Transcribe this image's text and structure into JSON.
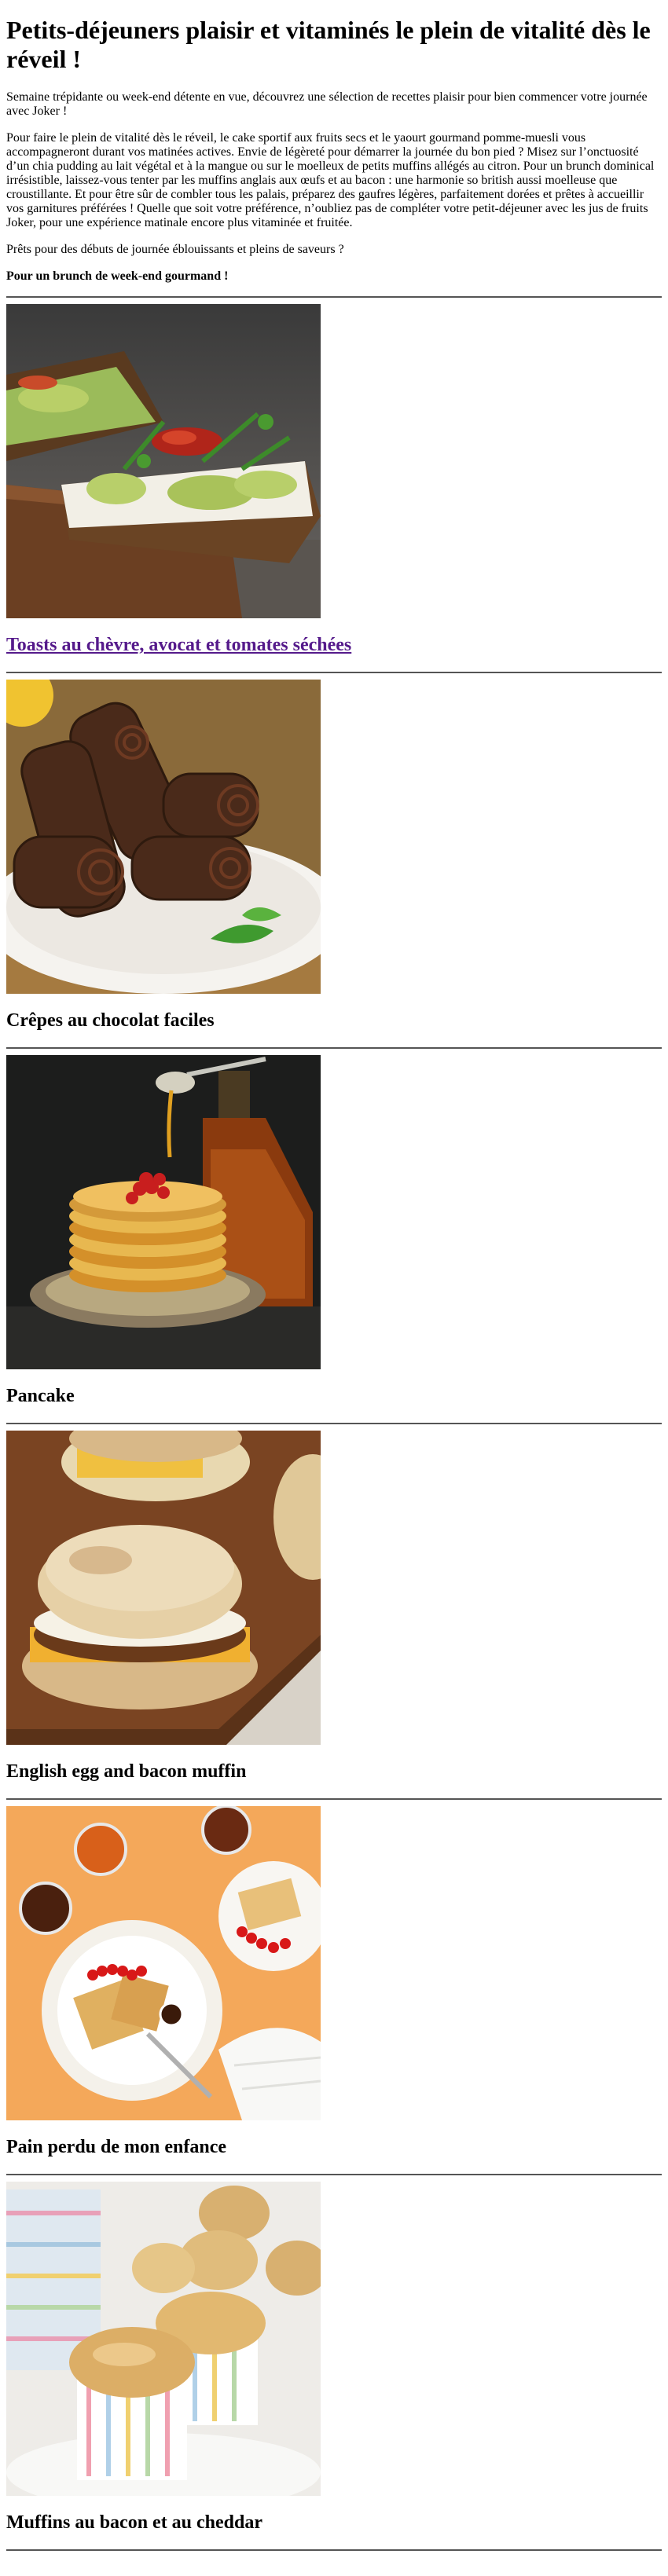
{
  "article": {
    "title": "Petits-déjeuners plaisir et vitaminés le plein de vitalité dès le réveil !",
    "intro_1": "Semaine trépidante ou week-end détente en vue, découvrez une sélection de recettes plaisir pour bien commencer votre journée avec Joker !",
    "intro_2": "Pour faire le plein de vitalité dès le réveil, le cake sportif aux fruits secs et le yaourt gourmand pomme-muesli vous accompagneront durant vos matinées actives. Envie de légèreté pour démarrer la journée du bon pied ? Misez sur l’onctuosité d’un chia pudding au lait végétal et à la mangue ou sur le moelleux de petits muffins allégés au citron. Pour un brunch dominical irrésistible, laissez-vous tenter par les muffins anglais aux œufs et au bacon : une harmonie so british aussi moelleuse que croustillante. Et pour être sûr de combler tous les palais, préparez des gaufres légères, parfaitement dorées et prêtes à accueillir vos garnitures préférées ! Quelle que soit votre préférence, n’oubliez pas de compléter votre petit-déjeuner avec les jus de fruits Joker, pour une expérience matinale encore plus vitaminée et fruitée.",
    "intro_3": "Prêts pour des débuts de journée éblouissants et pleins de saveurs ?",
    "section_heading": "Pour un brunch de week-end gourmand !"
  },
  "recipes": [
    {
      "title": "Toasts au chèvre, avocat et tomates séchées",
      "is_link": true,
      "image": "toast-photo"
    },
    {
      "title": "Crêpes au chocolat faciles",
      "is_link": false,
      "image": "crepes-photo"
    },
    {
      "title": "Pancake",
      "is_link": false,
      "image": "pancake-photo"
    },
    {
      "title": "English egg and bacon muffin",
      "is_link": false,
      "image": "muffin-sandwich-photo"
    },
    {
      "title": "Pain perdu de mon enfance",
      "is_link": false,
      "image": "french-toast-photo"
    },
    {
      "title": "Muffins au bacon et au cheddar",
      "is_link": false,
      "image": "cheddar-muffins-photo"
    }
  ],
  "colors": {
    "link": "#551a8b",
    "divider": "#555555"
  }
}
